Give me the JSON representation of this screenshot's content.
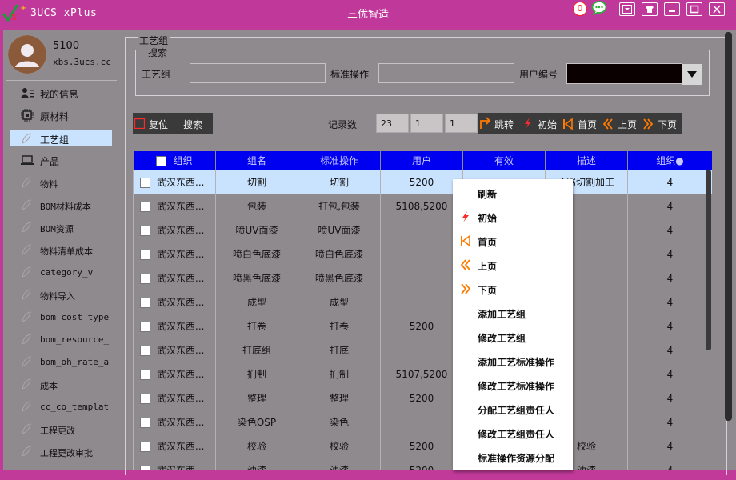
{
  "app": {
    "name": "3UCS xPlus",
    "window_title": "三优智造",
    "notification_count": "0"
  },
  "user": {
    "name": "5100",
    "email": "xbs.3ucs.cc"
  },
  "sidebar": {
    "items": [
      {
        "label": "我的信息",
        "icon": "user-info-icon"
      },
      {
        "label": "原材料",
        "icon": "chip-icon"
      },
      {
        "label": "工艺组",
        "icon": "leaf-icon",
        "selected": true
      },
      {
        "label": "产品",
        "icon": "laptop-icon"
      },
      {
        "label": "物料",
        "icon": "leaf-icon"
      },
      {
        "label": "BOM材料成本",
        "icon": "leaf-icon"
      },
      {
        "label": "BOM资源",
        "icon": "leaf-icon"
      },
      {
        "label": "物料清单成本",
        "icon": "leaf-icon"
      },
      {
        "label": "category_v",
        "icon": "leaf-icon"
      },
      {
        "label": "物料导入",
        "icon": "leaf-icon"
      },
      {
        "label": "bom_cost_type",
        "icon": "leaf-icon"
      },
      {
        "label": "bom_resource_",
        "icon": "leaf-icon"
      },
      {
        "label": "bom_oh_rate_a",
        "icon": "leaf-icon"
      },
      {
        "label": "成本",
        "icon": "leaf-icon"
      },
      {
        "label": "cc_co_templat",
        "icon": "leaf-icon"
      },
      {
        "label": "工程更改",
        "icon": "leaf-icon"
      },
      {
        "label": "工程更改审批",
        "icon": "leaf-icon"
      }
    ]
  },
  "panel": {
    "group_title": "工艺组",
    "search_title": "搜索",
    "fields": {
      "craft_group_label": "工艺组",
      "craft_group_value": "",
      "std_op_label": "标准操作",
      "std_op_value": "",
      "user_no_label": "用户编号",
      "user_no_value": ""
    }
  },
  "toolbar": {
    "reset_label": "复位",
    "search_label": "搜索",
    "records_label": "记录数",
    "records_count": "23",
    "page_current": "1",
    "page_total": "1",
    "jump_label": "跳转",
    "init_label": "初始",
    "first_label": "首页",
    "prev_label": "上页",
    "next_label": "下页"
  },
  "table": {
    "columns": [
      "组织",
      "组名",
      "标准操作",
      "用户",
      "有效",
      "描述",
      "组织●"
    ],
    "rows": [
      [
        "武汉东西...",
        "切割",
        "切割",
        "5200",
        "",
        "^骂切割加工",
        "4"
      ],
      [
        "武汉东西...",
        "包装",
        "打包,包装",
        "5108,5200",
        "",
        "",
        "4"
      ],
      [
        "武汉东西...",
        "喷UV面漆",
        "喷UV面漆",
        "",
        "",
        "",
        "4"
      ],
      [
        "武汉东西...",
        "喷白色底漆",
        "喷白色底漆",
        "",
        "",
        "",
        "4"
      ],
      [
        "武汉东西...",
        "喷黑色底漆",
        "喷黑色底漆",
        "",
        "",
        "",
        "4"
      ],
      [
        "武汉东西...",
        "成型",
        "成型",
        "",
        "",
        "",
        "4"
      ],
      [
        "武汉东西...",
        "打卷",
        "打卷",
        "5200",
        "",
        "",
        "4"
      ],
      [
        "武汉东西...",
        "打底组",
        "打底",
        "",
        "",
        "",
        "4"
      ],
      [
        "武汉东西...",
        "扪制",
        "扪制",
        "5107,5200",
        "",
        "",
        "4"
      ],
      [
        "武汉东西...",
        "整理",
        "整理",
        "5200",
        "",
        "",
        "4"
      ],
      [
        "武汉东西...",
        "染色OSP",
        "染色",
        "",
        "",
        "",
        "4"
      ],
      [
        "武汉东西...",
        "校验",
        "校验",
        "5200",
        "",
        "校验",
        "4"
      ],
      [
        "武汉东西...",
        "油漆",
        "油漆",
        "5200",
        "",
        "油漆",
        "4"
      ]
    ]
  },
  "context_menu": {
    "items": [
      {
        "label": "刷新",
        "icon": ""
      },
      {
        "label": "初始",
        "icon": "lightning-icon"
      },
      {
        "label": "首页",
        "icon": "first-page-icon"
      },
      {
        "label": "上页",
        "icon": "double-chevron-left-icon"
      },
      {
        "label": "下页",
        "icon": "double-chevron-right-icon"
      },
      {
        "label": "添加工艺组",
        "icon": ""
      },
      {
        "label": "修改工艺组",
        "icon": ""
      },
      {
        "label": "添加工艺标准操作",
        "icon": ""
      },
      {
        "label": "修改工艺标准操作",
        "icon": ""
      },
      {
        "label": "分配工艺组责任人",
        "icon": ""
      },
      {
        "label": "修改工艺组责任人",
        "icon": ""
      },
      {
        "label": "标准操作资源分配",
        "icon": ""
      }
    ]
  },
  "colors": {
    "title_bar": "#c0399a",
    "panel_bg": "#8f8a8e",
    "header_blue": "#0000f0",
    "selected_row": "#c9e3ff",
    "accent_orange": "#ff6a00"
  }
}
